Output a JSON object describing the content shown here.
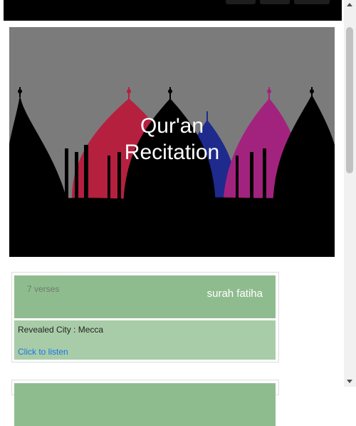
{
  "hero": {
    "title_line1": "Qur'an",
    "title_line2": "Recitation"
  },
  "cards": [
    {
      "verses": "7 verses",
      "name": "surah fatiha",
      "city": "Revealed City : Mecca",
      "listen": "Click to listen"
    }
  ],
  "colors": {
    "card_header": "#8fbc8f",
    "card_body": "#a8cca8",
    "link": "#1a73e8",
    "hero_overlay": "#7b7b7b"
  }
}
